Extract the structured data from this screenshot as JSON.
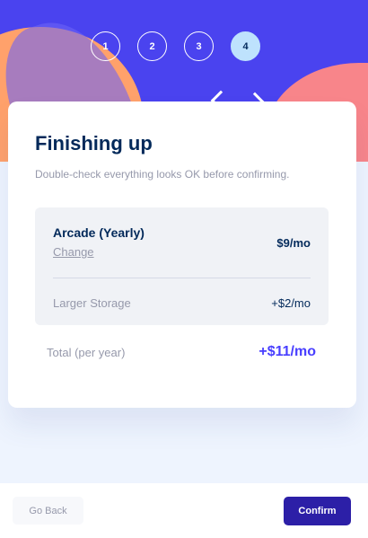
{
  "steps": [
    {
      "number": "1",
      "active": false
    },
    {
      "number": "2",
      "active": false
    },
    {
      "number": "3",
      "active": false
    },
    {
      "number": "4",
      "active": true
    }
  ],
  "summary": {
    "title": "Finishing up",
    "subtitle": "Double-check everything looks OK before confirming.",
    "plan": {
      "name": "Arcade (Yearly)",
      "change_label": "Change",
      "price": "$9/mo"
    },
    "addons": [
      {
        "name": "Larger Storage",
        "price": "+$2/mo"
      }
    ],
    "total": {
      "label": "Total (per year)",
      "price": "+$11/mo"
    }
  },
  "footer": {
    "back_label": "Go Back",
    "confirm_label": "Confirm"
  },
  "colors": {
    "hero_bg": "#4a43ef",
    "accent": "#483eff",
    "confirm_bg": "#2c1fa7",
    "marine_blue": "#02295a",
    "cool_gray": "#9699ab",
    "active_step": "#bee2fd"
  }
}
